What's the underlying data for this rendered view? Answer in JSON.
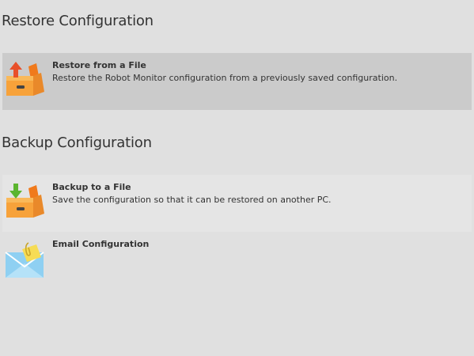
{
  "restore": {
    "heading": "Restore Configuration",
    "items": [
      {
        "title": "Restore from a File",
        "description": "Restore the Robot Monitor configuration from a previously saved configuration.",
        "icon": "box-upload-icon"
      }
    ]
  },
  "backup": {
    "heading": "Backup Configuration",
    "items": [
      {
        "title": "Backup to a File",
        "description": "Save the configuration so that it can be restored on another PC.",
        "icon": "box-download-icon"
      },
      {
        "title": "Email Configuration",
        "description": "",
        "icon": "email-attachment-icon"
      }
    ]
  },
  "colors": {
    "background": "#e0e0e0",
    "selected_item": "#cbcbcb",
    "hover_item": "#e5e5e5",
    "box_orange": "#f7a23a",
    "arrow_red": "#e8502a",
    "arrow_green": "#5bb52f",
    "envelope_blue": "#7ec8ee"
  }
}
